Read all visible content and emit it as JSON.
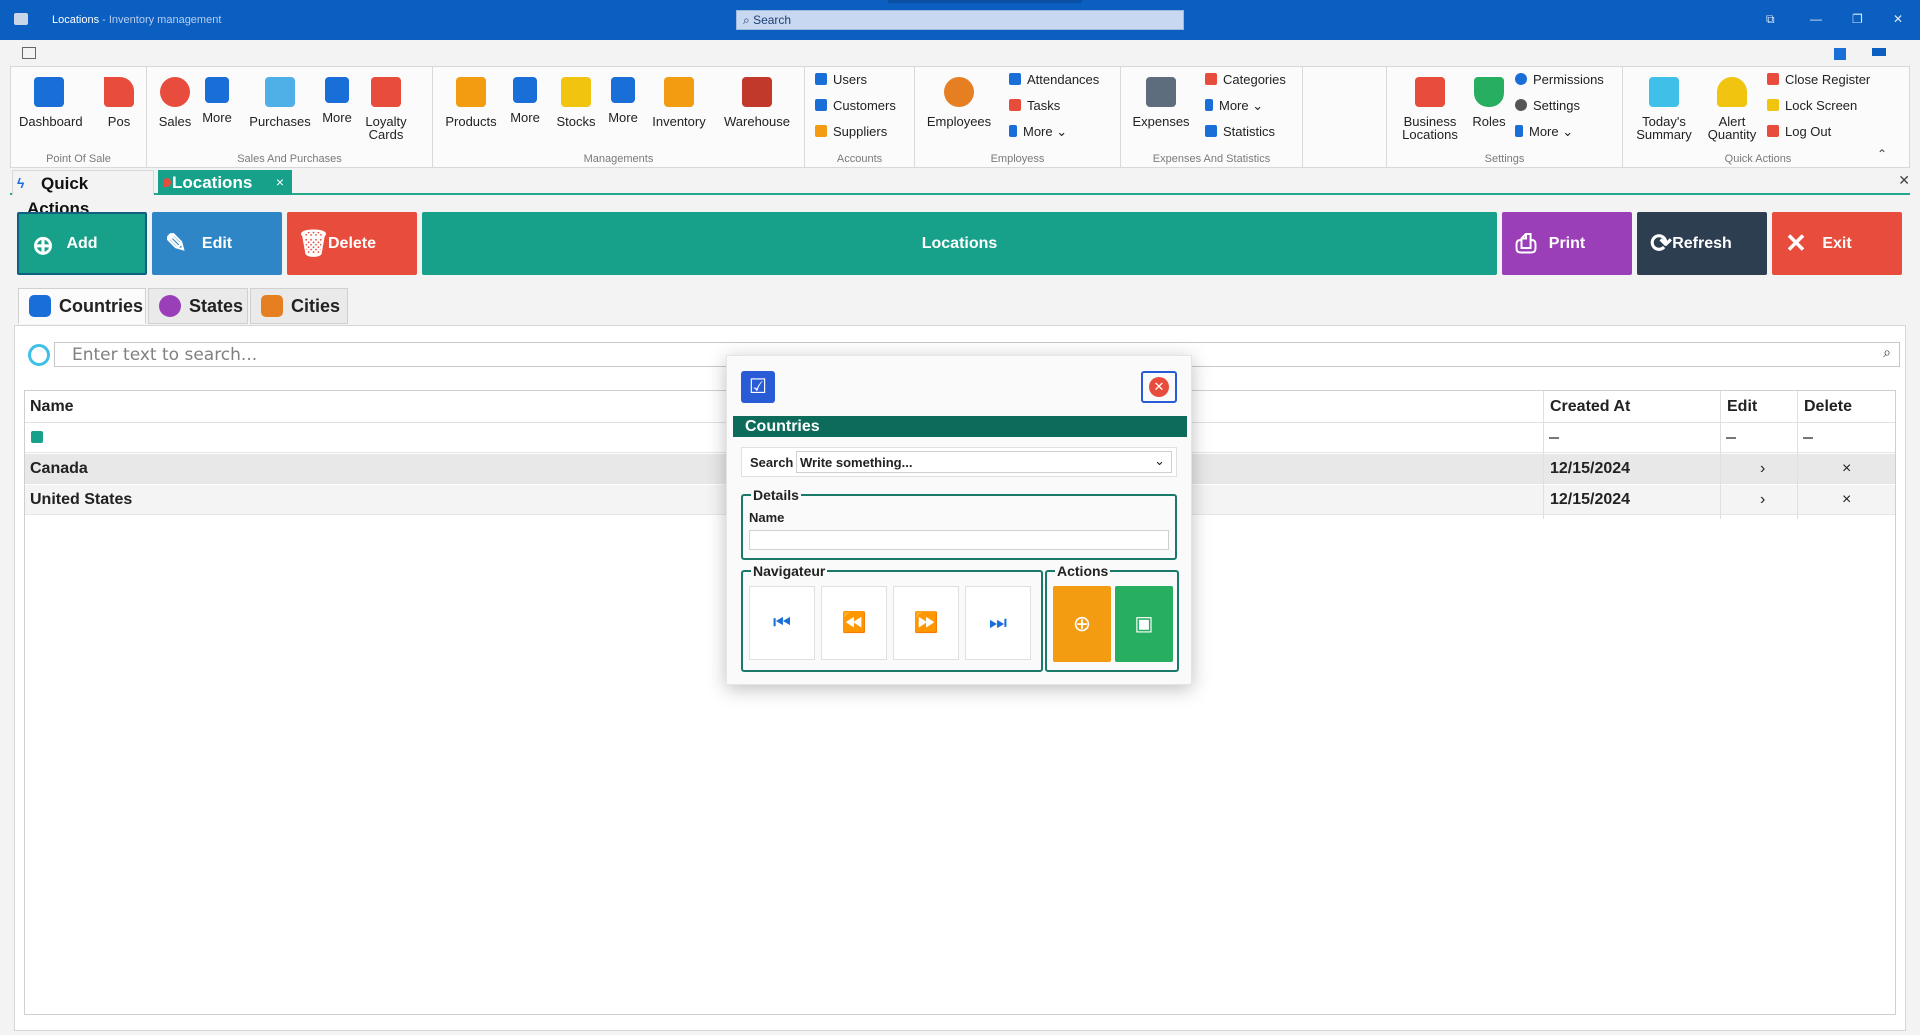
{
  "window": {
    "title": "Locations",
    "subtitle": " - Inventory management",
    "search_placeholder": "Search"
  },
  "ribbon": {
    "groups": [
      {
        "label": "Point Of Sale",
        "items": [
          "Dashboard",
          "Pos"
        ]
      },
      {
        "label": "Sales And Purchases",
        "items": [
          "Sales",
          "More",
          "Purchases",
          "More",
          "Loyalty Cards"
        ]
      },
      {
        "label": "Managements",
        "items": [
          "Products",
          "More",
          "Stocks",
          "More",
          "Inventory",
          "Warehouse"
        ]
      },
      {
        "label": "Accounts",
        "items": [
          "Users",
          "Customers",
          "Suppliers"
        ]
      },
      {
        "label": "Employess",
        "items": [
          "Employees",
          "Attendances",
          "Tasks",
          "More"
        ]
      },
      {
        "label": "Expenses And Statistics",
        "items": [
          "Expenses",
          "Categories",
          "More",
          "Statistics"
        ]
      },
      {
        "label": "Settings",
        "items": [
          "Business Locations",
          "Roles",
          "Permissions",
          "Settings",
          "More"
        ]
      },
      {
        "label": "Quick Actions",
        "items": [
          "Today's Summary",
          "Alert Quantity",
          "Close Register",
          "Lock Screen",
          "Log Out"
        ]
      }
    ]
  },
  "tabs": {
    "quick_actions": "Quick Actions",
    "locations": "Locations",
    "close": "×"
  },
  "toolbar": {
    "add": "Add",
    "edit": "Edit",
    "delete": "Delete",
    "title": "Locations",
    "print": "Print",
    "refresh": "Refresh",
    "exit": "Exit"
  },
  "subtabs": [
    "Countries",
    "States",
    "Cities"
  ],
  "search": {
    "placeholder": "Enter text to search..."
  },
  "grid": {
    "columns": [
      "Name",
      "Created At",
      "Edit",
      "Delete"
    ],
    "rows": [
      {
        "name": "Canada",
        "created_at": "12/15/2024",
        "edit": "›",
        "delete": "×"
      },
      {
        "name": "United States",
        "created_at": "12/15/2024",
        "edit": "›",
        "delete": "×"
      }
    ]
  },
  "dialog": {
    "title": "Countries",
    "search_label": "Search",
    "search_value": "Write something...",
    "details_legend": "Details",
    "name_label": "Name",
    "name_value": "",
    "nav_legend": "Navigateur",
    "actions_legend": "Actions"
  },
  "colors": {
    "titlebar": "#0b5fc1",
    "accent": "#17a08a",
    "add": "#17a08a",
    "edit": "#2f86c6",
    "delete": "#e74c3c",
    "print": "#9b3fb8",
    "refresh": "#2c3e50",
    "exit": "#e74c3c"
  }
}
